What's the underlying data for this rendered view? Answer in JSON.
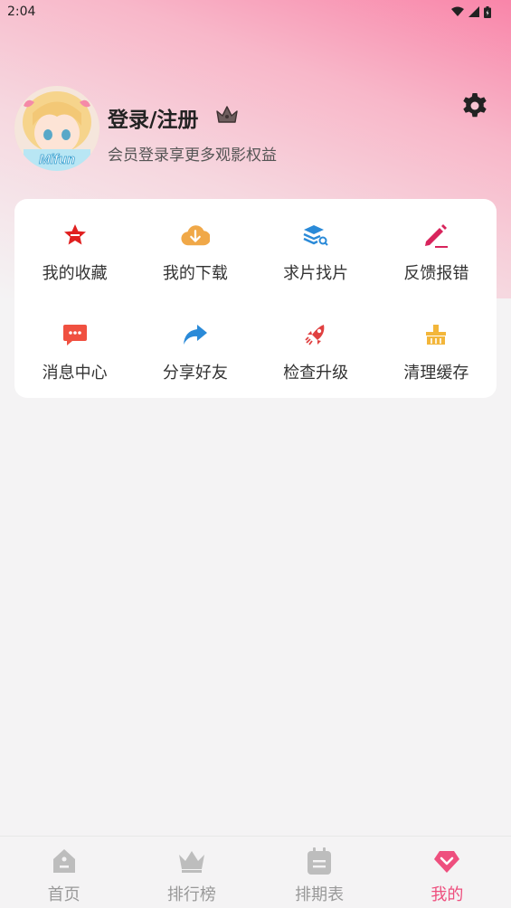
{
  "status": {
    "time": "2:04"
  },
  "profile": {
    "title": "登录/注册",
    "subtitle": "会员登录享更多观影权益",
    "avatar_text": "Mifun"
  },
  "menu": [
    {
      "label": "我的收藏",
      "icon": "star-icon",
      "color": "#e02020"
    },
    {
      "label": "我的下载",
      "icon": "cloud-download-icon",
      "color": "#f0a848"
    },
    {
      "label": "求片找片",
      "icon": "layers-search-icon",
      "color": "#2a8ad8"
    },
    {
      "label": "反馈报错",
      "icon": "pencil-icon",
      "color": "#d8245c"
    },
    {
      "label": "消息中心",
      "icon": "message-icon",
      "color": "#f05040"
    },
    {
      "label": "分享好友",
      "icon": "share-icon",
      "color": "#2a8ad8"
    },
    {
      "label": "检查升级",
      "icon": "rocket-icon",
      "color": "#e04040"
    },
    {
      "label": "清理缓存",
      "icon": "broom-icon",
      "color": "#f3b63a"
    }
  ],
  "nav": [
    {
      "label": "首页",
      "icon": "home-icon",
      "active": false
    },
    {
      "label": "排行榜",
      "icon": "crown-icon",
      "active": false
    },
    {
      "label": "排期表",
      "icon": "calendar-icon",
      "active": false
    },
    {
      "label": "我的",
      "icon": "heart-icon",
      "active": true
    }
  ],
  "colors": {
    "accent": "#ee4f7e",
    "inactive": "#bdbdbd"
  }
}
